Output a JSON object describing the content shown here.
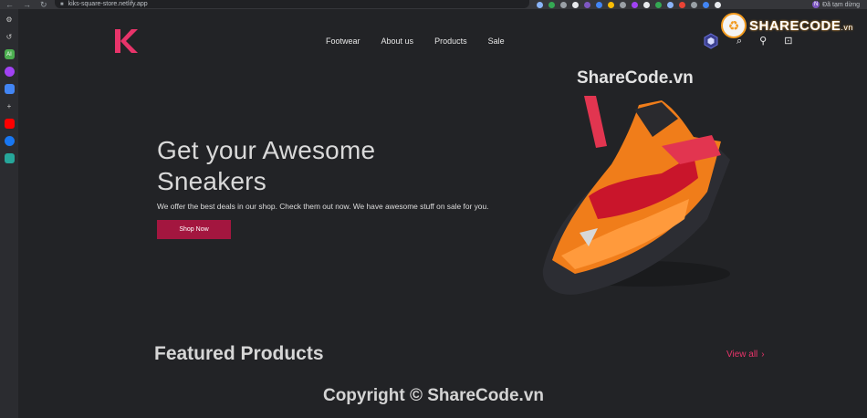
{
  "browser": {
    "url": "kiks-square-store.netlify.app",
    "profile_label": "Đã tạm dừng",
    "nav_back": "←",
    "nav_forward": "→",
    "reload": "↻"
  },
  "site": {
    "logo_letter": "K",
    "nav": [
      "Footwear",
      "About us",
      "Products",
      "Sale"
    ],
    "icons": {
      "search": "⌕",
      "account": "⚲",
      "cart": "⊡"
    }
  },
  "hero": {
    "title_line1": "Get your Awesome",
    "title_line2": "Sneakers",
    "subtitle": "We offer the best deals in our shop. Check them out now. We have awesome stuff on sale for you.",
    "button": "Shop Now"
  },
  "featured": {
    "heading": "Featured Products",
    "view_all": "View all",
    "view_all_icon": "›"
  },
  "watermarks": {
    "logo_text": "SHARECODE",
    "logo_suffix": ".vn",
    "mid": "ShareCode.vn",
    "bottom": "Copyright © ShareCode.vn"
  },
  "colors": {
    "background": "#222326",
    "accent": "#e8346a",
    "button": "#a3163f",
    "logo": "#e8346a"
  }
}
